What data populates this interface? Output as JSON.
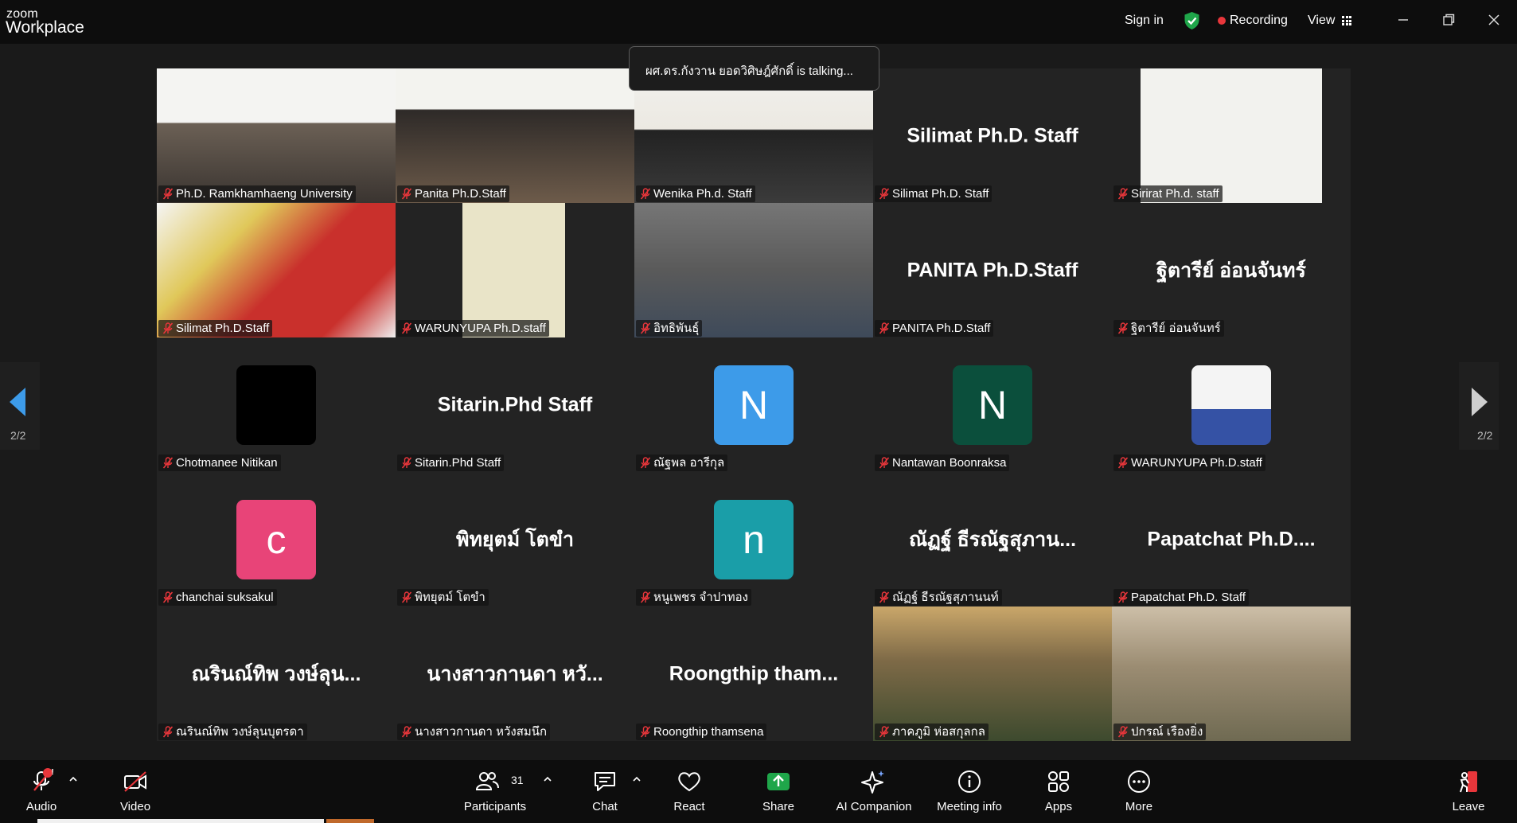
{
  "app": {
    "brand_small": "zoom",
    "brand_big": "Workplace"
  },
  "titlebar": {
    "sign_in": "Sign in",
    "recording": "Recording",
    "view": "View"
  },
  "talking_banner": "ผศ.ดร.กังวาน ยอดวิศิษฎ์ศักดิ์ is talking...",
  "pager": {
    "left": "2/2",
    "right": "2/2"
  },
  "tiles": [
    {
      "name": "Ph.D. Ramkhamhaeng University",
      "type": "video",
      "center": ""
    },
    {
      "name": "Panita Ph.D.Staff",
      "type": "video",
      "center": ""
    },
    {
      "name": "Wenika Ph.d. Staff",
      "type": "video",
      "center": ""
    },
    {
      "name": "Silimat Ph.D. Staff",
      "type": "text",
      "center": "Silimat Ph.D. Staff"
    },
    {
      "name": "Sirirat Ph.d. staff",
      "type": "video",
      "center": ""
    },
    {
      "name": "Silimat Ph.D.Staff",
      "type": "video",
      "center": ""
    },
    {
      "name": "WARUNYUPA Ph.D.staff",
      "type": "video",
      "center": ""
    },
    {
      "name": "อิทธิพันธุ์",
      "type": "video",
      "center": ""
    },
    {
      "name": "PANITA Ph.D.Staff",
      "type": "text",
      "center": "PANITA Ph.D.Staff"
    },
    {
      "name": "ฐิตารีย์ อ่อนจันทร์",
      "type": "text",
      "center": "ฐิตารีย์ อ่อนจันทร์"
    },
    {
      "name": "Chotmanee Nitikan",
      "type": "avatar",
      "center": "",
      "letter": "",
      "color": "#000000"
    },
    {
      "name": "Sitarin.Phd Staff",
      "type": "text",
      "center": "Sitarin.Phd Staff"
    },
    {
      "name": "ณัฐพล อารีกุล",
      "type": "avatar",
      "center": "",
      "letter": "N",
      "color": "#3d9be9"
    },
    {
      "name": "Nantawan Boonraksa",
      "type": "avatar",
      "center": "",
      "letter": "N",
      "color": "#0b4f3c"
    },
    {
      "name": "WARUNYUPA Ph.D.staff",
      "type": "photo",
      "center": ""
    },
    {
      "name": "chanchai suksakul",
      "type": "avatar",
      "center": "",
      "letter": "c",
      "color": "#e84478"
    },
    {
      "name": "พิทยุตม์ โตขำ",
      "type": "text",
      "center": "พิทยุตม์ โตขำ"
    },
    {
      "name": "หนูเพชร จำปาทอง",
      "type": "avatar",
      "center": "",
      "letter": "n",
      "color": "#1a9ea8"
    },
    {
      "name": "ณัฏฐ์ ธีรณัฐสุภานนท์",
      "type": "text",
      "center": "ณัฏฐ์ ธีรณัฐสุภาน..."
    },
    {
      "name": "Papatchat Ph.D. Staff",
      "type": "text",
      "center": "Papatchat Ph.D...."
    },
    {
      "name": "ณรินณ์ทิพ วงษ์ลุนบุตรดา",
      "type": "text",
      "center": "ณรินณ์ทิพ วงษ์ลุน..."
    },
    {
      "name": "นางสาวกานดา หวังสมนึก",
      "type": "text",
      "center": "นางสาวกานดา หวั..."
    },
    {
      "name": "Roongthip thamsena",
      "type": "text",
      "center": "Roongthip tham..."
    },
    {
      "name": "ภาคภูมิ ห่อสกุลกล",
      "type": "video",
      "center": ""
    },
    {
      "name": "ปกรณ์ เรืองยิ่ง",
      "type": "video",
      "center": ""
    }
  ],
  "toolbar": {
    "audio": "Audio",
    "video": "Video",
    "participants": "Participants",
    "participant_count": "31",
    "chat": "Chat",
    "react": "React",
    "share": "Share",
    "ai_companion": "AI Companion",
    "meeting_info": "Meeting info",
    "apps": "Apps",
    "more": "More",
    "leave": "Leave",
    "audio_badge": "!"
  },
  "colors": {
    "accent": "#0b5cff",
    "recording": "#e8363b",
    "share": "#1fa64a",
    "shield": "#1fa64a"
  }
}
